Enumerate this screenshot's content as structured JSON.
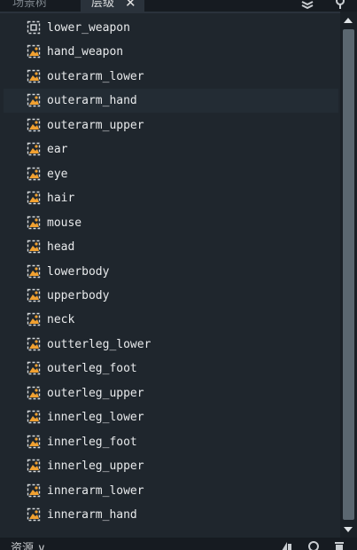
{
  "tabs": {
    "inactive_label": "场景树",
    "active_label": "层级",
    "close_glyph": "✕"
  },
  "tree": {
    "highlighted_index": 3,
    "items": [
      {
        "label": "lower_weapon",
        "icon": "node-icon"
      },
      {
        "label": "hand_weapon",
        "icon": "sprite-icon"
      },
      {
        "label": "outerarm_lower",
        "icon": "sprite-icon"
      },
      {
        "label": "outerarm_hand",
        "icon": "sprite-icon"
      },
      {
        "label": "outerarm_upper",
        "icon": "sprite-icon"
      },
      {
        "label": "ear",
        "icon": "sprite-icon"
      },
      {
        "label": "eye",
        "icon": "sprite-icon"
      },
      {
        "label": "hair",
        "icon": "sprite-icon"
      },
      {
        "label": "mouse",
        "icon": "sprite-icon"
      },
      {
        "label": "head",
        "icon": "sprite-icon"
      },
      {
        "label": "lowerbody",
        "icon": "sprite-icon"
      },
      {
        "label": "upperbody",
        "icon": "sprite-icon"
      },
      {
        "label": "neck",
        "icon": "sprite-icon"
      },
      {
        "label": "outterleg_lower",
        "icon": "sprite-icon"
      },
      {
        "label": "outerleg_foot",
        "icon": "sprite-icon"
      },
      {
        "label": "outerleg_upper",
        "icon": "sprite-icon"
      },
      {
        "label": "innerleg_lower",
        "icon": "sprite-icon"
      },
      {
        "label": "innerleg_foot",
        "icon": "sprite-icon"
      },
      {
        "label": "innerleg_upper",
        "icon": "sprite-icon"
      },
      {
        "label": "innerarm_lower",
        "icon": "sprite-icon"
      },
      {
        "label": "innerarm_hand",
        "icon": "sprite-icon"
      }
    ]
  },
  "bottom": {
    "tab_label": "资源 ∨"
  },
  "colors": {
    "background": "#1f262d",
    "highlight_row": "#232c34",
    "sprite_icon_accent": "#f0a030",
    "text": "#e8eaec",
    "scroll_thumb": "#5b6770"
  }
}
